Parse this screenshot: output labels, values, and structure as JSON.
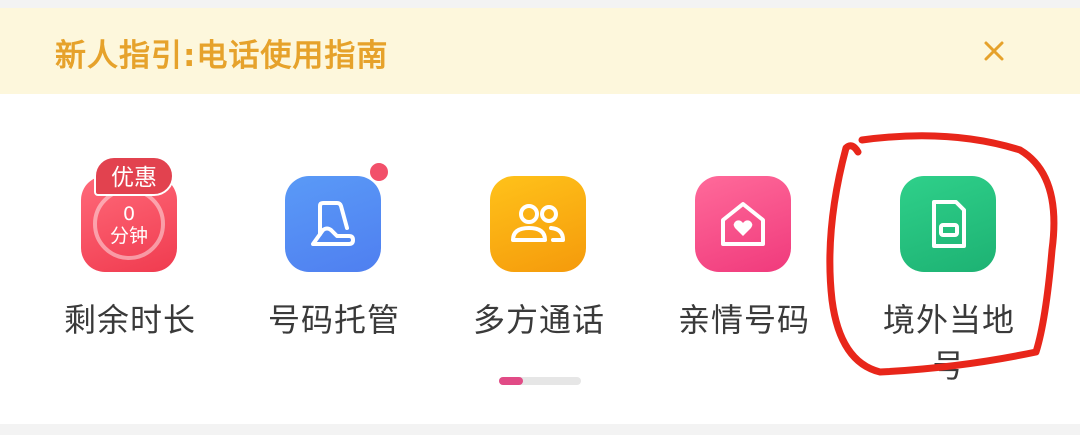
{
  "banner": {
    "title": "新人指引:电话使用指南",
    "close_icon": "close-icon",
    "accent_color": "#e6a22b",
    "background": "#fdf7dc"
  },
  "services": {
    "items": [
      {
        "key": "remaining-time",
        "label": "剩余时长",
        "icon": "minutes-ring-icon",
        "badge": "优惠",
        "minutes_value": "0",
        "minutes_unit": "分钟",
        "color": "#f03b4f"
      },
      {
        "key": "number-hosting",
        "label": "号码托管",
        "icon": "hand-card-icon",
        "has_red_dot": true,
        "color": "#4f7ff0"
      },
      {
        "key": "multi-party-call",
        "label": "多方通话",
        "icon": "group-people-icon",
        "color": "#f59a0b"
      },
      {
        "key": "family-number",
        "label": "亲情号码",
        "icon": "heart-house-icon",
        "color": "#f03a7c"
      },
      {
        "key": "overseas-local-number",
        "label": "境外当地号",
        "icon": "sim-card-icon",
        "color": "#1db273"
      }
    ]
  },
  "pager": {
    "pages": 2,
    "active_page": 1,
    "active_color": "#e14b86"
  },
  "annotation": {
    "shape": "hand-drawn-circle",
    "color": "#e8261a",
    "target": "overseas-local-number"
  }
}
